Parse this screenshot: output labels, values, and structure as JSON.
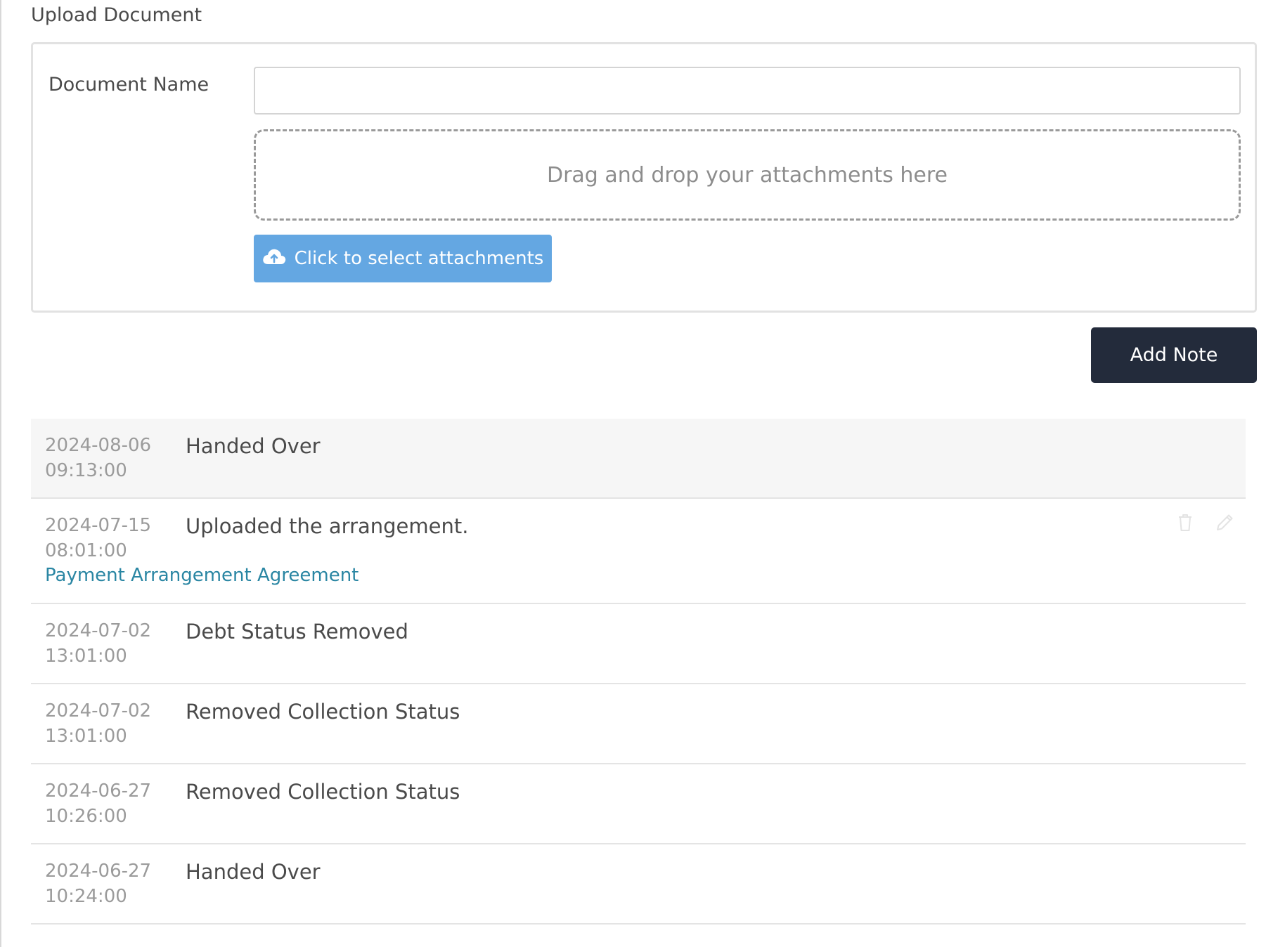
{
  "upload": {
    "section_title": "Upload Document",
    "document_name_label": "Document Name",
    "document_name_value": "",
    "document_name_placeholder": "",
    "dropzone_text": "Drag and drop your attachments here",
    "select_button_label": "Click to select attachments",
    "select_button_icon": "cloud-upload-icon"
  },
  "actions": {
    "add_note_label": "Add Note"
  },
  "notes": [
    {
      "date": "2024-08-06",
      "time": "09:13:00",
      "text": "Handed Over",
      "link": ""
    },
    {
      "date": "2024-07-15",
      "time": "08:01:00",
      "text": "Uploaded the arrangement.",
      "link": "Payment Arrangement Agreement"
    },
    {
      "date": "2024-07-02",
      "time": "13:01:00",
      "text": "Debt Status Removed",
      "link": ""
    },
    {
      "date": "2024-07-02",
      "time": "13:01:00",
      "text": "Removed Collection Status",
      "link": ""
    },
    {
      "date": "2024-06-27",
      "time": "10:26:00",
      "text": "Removed Collection Status",
      "link": ""
    },
    {
      "date": "2024-06-27",
      "time": "10:24:00",
      "text": "Handed Over",
      "link": ""
    }
  ],
  "colors": {
    "primary_button": "#64a7e2",
    "dark_button": "#232b3b",
    "link": "#2a86a3"
  }
}
